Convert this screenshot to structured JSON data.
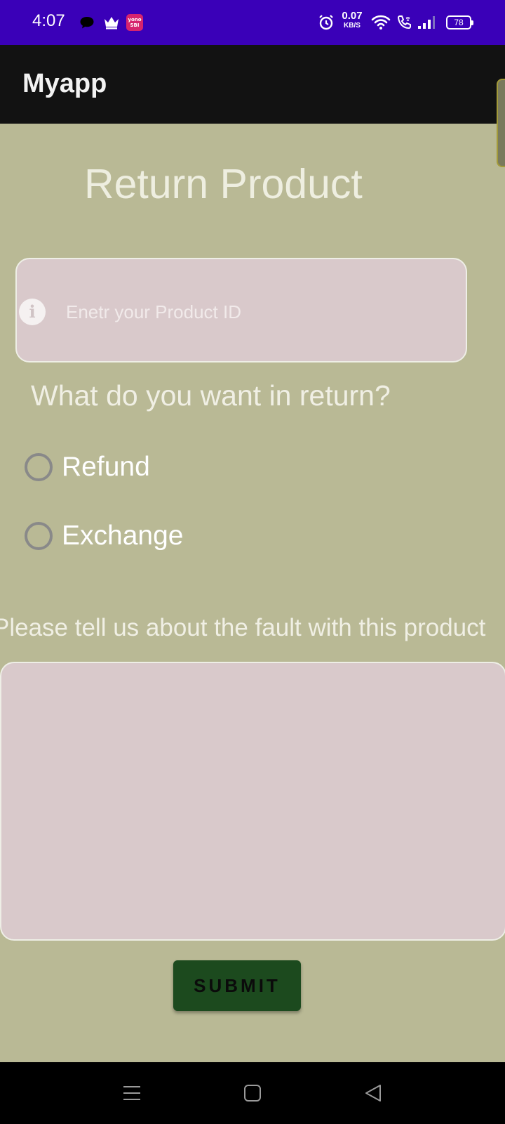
{
  "status_bar": {
    "time": "4:07",
    "net_speed_value": "0.07",
    "net_speed_unit": "KB/S",
    "battery": "78",
    "yono_label_top": "yono",
    "yono_label_bottom": "SBI",
    "icons": [
      "chat-icon",
      "crown-icon",
      "yono-sbi-icon",
      "alarm-icon",
      "wifi-icon",
      "wifi-call-icon",
      "signal-icon",
      "battery-icon"
    ]
  },
  "app_bar": {
    "title": "Myapp"
  },
  "main": {
    "heading": "Return Product",
    "product_id": {
      "placeholder": "Enetr your Product ID",
      "value": "",
      "icon": "info-icon",
      "icon_glyph": "i"
    },
    "return_question": "What do you want in return?",
    "options": [
      {
        "label": "Refund",
        "selected": false
      },
      {
        "label": "Exchange",
        "selected": false
      }
    ],
    "fault_question": "Please tell us about the fault with this product",
    "fault_value": "",
    "submit_label": "SUBMIT"
  },
  "nav_bar": {
    "icons": [
      "menu-icon",
      "home-icon",
      "back-icon"
    ]
  },
  "colors": {
    "status_bar_bg": "#3a00b8",
    "app_bar_bg": "#121212",
    "page_bg": "#b9b995",
    "input_bg": "#d9c9cb",
    "submit_bg": "#1c4a1e"
  }
}
